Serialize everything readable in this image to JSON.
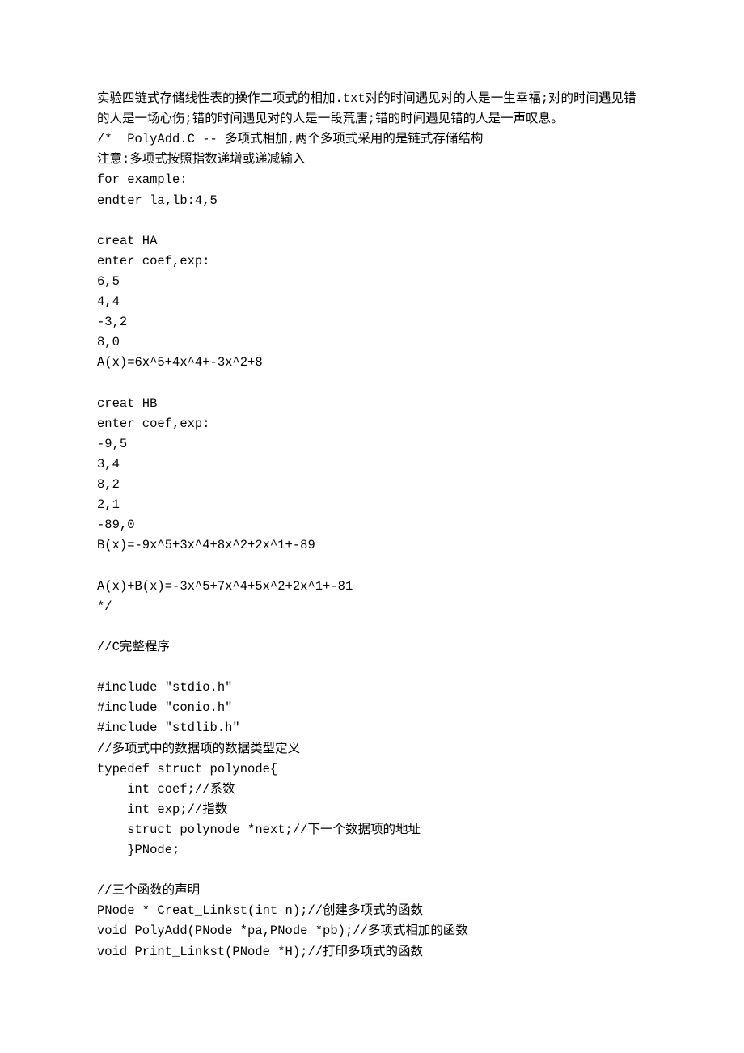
{
  "lines": [
    {
      "text": "实验四链式存储线性表的操作二项式的相加.txt对的时间遇见对的人是一生幸福;对的时间遇见错的人是一场心伤;错的时间遇见对的人是一段荒唐;错的时间遇见错的人是一声叹息。",
      "indent": false
    },
    {
      "text": "/*  PolyAdd.C -- 多项式相加,两个多项式采用的是链式存储结构",
      "indent": false
    },
    {
      "text": "注意:多项式按照指数递增或递减输入",
      "indent": false
    },
    {
      "text": "for example:",
      "indent": false
    },
    {
      "text": "endter la,lb:4,5",
      "indent": false
    },
    {
      "text": "",
      "indent": false
    },
    {
      "text": "creat HA",
      "indent": false
    },
    {
      "text": "enter coef,exp:",
      "indent": false
    },
    {
      "text": "6,5",
      "indent": false
    },
    {
      "text": "4,4",
      "indent": false
    },
    {
      "text": "-3,2",
      "indent": false
    },
    {
      "text": "8,0",
      "indent": false
    },
    {
      "text": "A(x)=6x^5+4x^4+-3x^2+8",
      "indent": false
    },
    {
      "text": "",
      "indent": false
    },
    {
      "text": "creat HB",
      "indent": false
    },
    {
      "text": "enter coef,exp:",
      "indent": false
    },
    {
      "text": "-9,5",
      "indent": false
    },
    {
      "text": "3,4",
      "indent": false
    },
    {
      "text": "8,2",
      "indent": false
    },
    {
      "text": "2,1",
      "indent": false
    },
    {
      "text": "-89,0",
      "indent": false
    },
    {
      "text": "B(x)=-9x^5+3x^4+8x^2+2x^1+-89",
      "indent": false
    },
    {
      "text": "",
      "indent": false
    },
    {
      "text": "A(x)+B(x)=-3x^5+7x^4+5x^2+2x^1+-81",
      "indent": false
    },
    {
      "text": "*/",
      "indent": false
    },
    {
      "text": "",
      "indent": false
    },
    {
      "text": "//C完整程序",
      "indent": false
    },
    {
      "text": "",
      "indent": false
    },
    {
      "text": "#include \"stdio.h\"",
      "indent": false
    },
    {
      "text": "#include \"conio.h\"",
      "indent": false
    },
    {
      "text": "#include \"stdlib.h\"",
      "indent": false
    },
    {
      "text": "//多项式中的数据项的数据类型定义",
      "indent": false
    },
    {
      "text": "typedef struct polynode{",
      "indent": false
    },
    {
      "text": "int coef;//系数",
      "indent": true
    },
    {
      "text": "int exp;//指数",
      "indent": true
    },
    {
      "text": "struct polynode *next;//下一个数据项的地址",
      "indent": true
    },
    {
      "text": "}PNode;",
      "indent": true
    },
    {
      "text": "",
      "indent": false
    },
    {
      "text": "//三个函数的声明",
      "indent": false
    },
    {
      "text": "PNode * Creat_Linkst(int n);//创建多项式的函数",
      "indent": false
    },
    {
      "text": "void PolyAdd(PNode *pa,PNode *pb);//多项式相加的函数",
      "indent": false
    },
    {
      "text": "void Print_Linkst(PNode *H);//打印多项式的函数",
      "indent": false
    }
  ]
}
